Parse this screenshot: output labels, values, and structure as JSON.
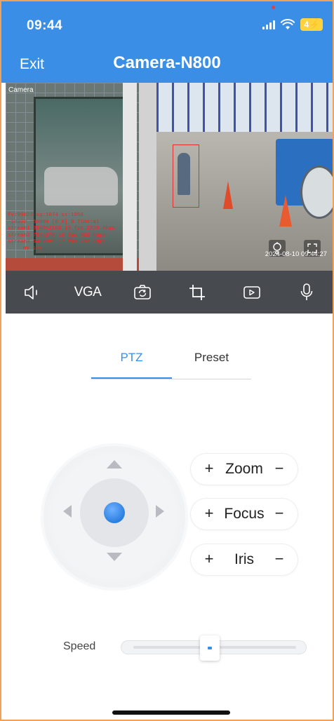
{
  "status_bar": {
    "time": "09:44",
    "battery": "4"
  },
  "header": {
    "exit_label": "Exit",
    "title": "Camera-N800"
  },
  "video": {
    "camera_label": "Camera",
    "overlay_lines": [
      "fv:99023 sg:1074 ss:1956",
      "~10000 ~50000 [0 0] 0 Time:a1",
      "stream1 3840x2160 16 fps 2526 kbps",
      "stream2 704x576 16 fps 663 kbps",
      "stream3 640x480 17 fps 753 kbps",
      "HV 1C1"
    ],
    "timestamp": "2024-08-10 09:44:27"
  },
  "toolbar": {
    "items": [
      {
        "icon": "speaker-icon"
      },
      {
        "label": "VGA"
      },
      {
        "icon": "camera-switch-icon"
      },
      {
        "icon": "crop-icon"
      },
      {
        "icon": "video-record-icon"
      },
      {
        "icon": "microphone-icon"
      }
    ]
  },
  "tabs": {
    "ptz": "PTZ",
    "preset": "Preset",
    "active": "PTZ"
  },
  "controls": {
    "plus": "+",
    "minus": "−",
    "zoom": "Zoom",
    "focus": "Focus",
    "iris": "Iris"
  },
  "speed": {
    "label": "Speed",
    "value_fraction": 0.5
  },
  "colors": {
    "accent": "#3a8ee6",
    "toolbar_bg": "#474a4e",
    "frame_border": "#f0a15a"
  }
}
